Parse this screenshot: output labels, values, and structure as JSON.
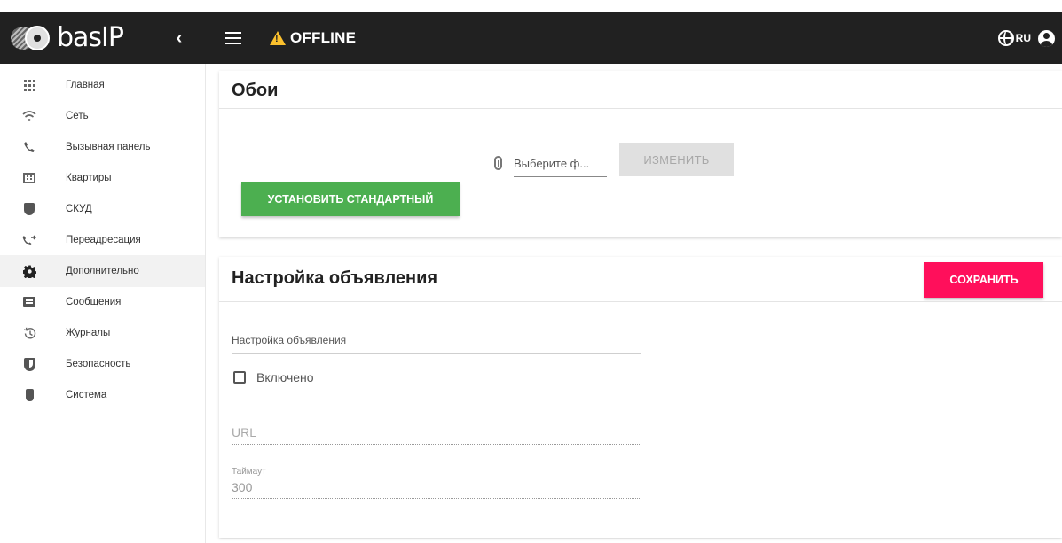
{
  "header": {
    "logo_text": "basIP",
    "collapse_icon": "chevron-left",
    "menu_icon": "hamburger-menu",
    "status_icon": "warning-triangle",
    "status_text": "OFFLINE",
    "language_icon": "globe",
    "language": "RU",
    "account_icon": "account-circle",
    "colors": {
      "background": "#212121",
      "warning": "#fbc02d"
    }
  },
  "sidebar": {
    "items": [
      {
        "label": "Главная",
        "icon": "grid-icon"
      },
      {
        "label": "Сеть",
        "icon": "wifi-icon"
      },
      {
        "label": "Вызывная панель",
        "icon": "phone-icon"
      },
      {
        "label": "Квартиры",
        "icon": "building-icon"
      },
      {
        "label": "СКУД",
        "icon": "shield-check-icon"
      },
      {
        "label": "Переадресация",
        "icon": "phone-forward-icon"
      },
      {
        "label": "Дополнительно",
        "icon": "gear-icon",
        "active": true
      },
      {
        "label": "Сообщения",
        "icon": "message-icon"
      },
      {
        "label": "Журналы",
        "icon": "history-icon"
      },
      {
        "label": "Безопасность",
        "icon": "security-icon"
      },
      {
        "label": "Система",
        "icon": "system-icon"
      }
    ]
  },
  "wallpaper": {
    "title": "Обои",
    "file_placeholder": "Выберите ф...",
    "change_label": "ИЗМЕНИТЬ",
    "default_label": "УСТАНОВИТЬ СТАНДАРТНЫЙ",
    "colors": {
      "default_button": "#4caf50"
    }
  },
  "announcement": {
    "title": "Настройка объявления",
    "save_label": "СОХРАНИТЬ",
    "text_placeholder": "Настройка объявления",
    "enabled_label": "Включено",
    "enabled": false,
    "url_placeholder": "URL",
    "timeout_label": "Таймаут",
    "timeout_value": "300",
    "colors": {
      "save_button": "#ff0f5b"
    }
  }
}
